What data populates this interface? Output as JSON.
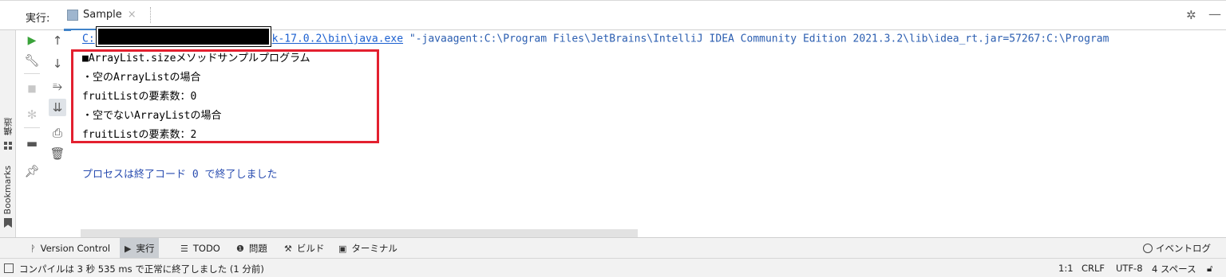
{
  "run_panel": {
    "label": "実行:",
    "tab_name": "Sample",
    "tab_close": "×",
    "settings_icon": "gear-icon",
    "minimize_icon": "minimize-icon"
  },
  "left_strip": {
    "structure_label": "構造",
    "bookmarks_label": "Bookmarks"
  },
  "toolbar": {
    "col1": [
      "run-icon",
      "wrench-icon",
      "stop-icon",
      "debug-icon",
      "layout-icon",
      "pin-icon"
    ],
    "col2": [
      "arrow-up-icon",
      "arrow-down-icon",
      "soft-wrap-icon",
      "scroll-to-end-icon",
      "print-icon",
      "trash-icon"
    ]
  },
  "console": {
    "cmd_prefix": "C:",
    "cmd_path_tail": "k-17.0.2\\bin\\java.exe",
    "cmd_args": " \"-javaagent:C:\\Program Files\\JetBrains\\IntelliJ IDEA Community Edition 2021.3.2\\lib\\idea_rt.jar=57267:C:\\Program",
    "lines": [
      "■ArrayList.sizeメソッドサンプルプログラム",
      "・空のArrayListの場合",
      "fruitListの要素数：0",
      "・空でないArrayListの場合",
      "fruitListの要素数：2"
    ],
    "exit_message": "プロセスは終了コード 0 で終了しました"
  },
  "tool_windows": {
    "version_control": "Version Control",
    "run": "実行",
    "todo": "TODO",
    "problems": "問題",
    "build": "ビルド",
    "terminal": "ターミナル",
    "event_log": "イベントログ"
  },
  "status_bar": {
    "message": "コンパイルは 3 秒 535 ms で正常に終了しました (1 分前)",
    "position": "1:1",
    "line_separator": "CRLF",
    "encoding": "UTF-8",
    "indent": "4 スペース"
  },
  "colors": {
    "highlight_box": "#e3202f",
    "link": "#1a5fd0",
    "run_green": "#3aa33a",
    "tab_underline": "#4083c9"
  }
}
